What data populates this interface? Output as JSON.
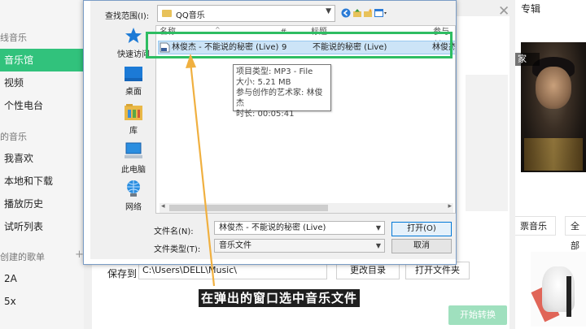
{
  "app": {
    "sidebar": {
      "section_top": "线音乐",
      "items_top": [
        "音乐馆",
        "视频",
        "个性电台"
      ],
      "section_mine": "的音乐",
      "items_mine": [
        "我喜欢",
        "本地和下载",
        "播放历史",
        "试听列表"
      ],
      "section_created": "创建的歌单",
      "plus": "+",
      "playlists": [
        "2A",
        "5x"
      ]
    },
    "header_tab": "专辑",
    "close_glyph": "✕",
    "artist_tag": "家",
    "pills": [
      "票音乐",
      "全部"
    ],
    "accent": "#31c27c"
  },
  "convert": {
    "save_label": "保存到",
    "save_path": "C:\\Users\\DELL\\Music\\",
    "change_dir_button": "更改目录",
    "open_folder_button": "打开文件夹",
    "start_button": "开始转换"
  },
  "dialog": {
    "look_in_label": "查找范围(I):",
    "look_in_value": "QQ音乐",
    "places": [
      "快速访问",
      "桌面",
      "库",
      "此电脑",
      "网络"
    ],
    "columns": [
      "名称",
      "#",
      "标题",
      "参与创"
    ],
    "file": {
      "name": "林俊杰 - 不能说的秘密 (Live)",
      "track": "9",
      "title": "不能说的秘密 (Live)",
      "artist": "林俊杰"
    },
    "tooltip": [
      "项目类型: MP3 - File",
      "大小: 5.21 MB",
      "参与创作的艺术家: 林俊杰",
      "时长: 00:05:41"
    ],
    "filename_label": "文件名(N):",
    "filename_value": "林俊杰 - 不能说的秘密 (Live)",
    "filetype_label": "文件类型(T):",
    "filetype_value": "音乐文件",
    "open_button": "打开(O)",
    "cancel_button": "取消"
  },
  "caption": "在弹出的窗口选中音乐文件",
  "colors": {
    "highlight_box": "#2ebd62",
    "arrow": "#f0b040",
    "selection": "#cce4f7"
  }
}
